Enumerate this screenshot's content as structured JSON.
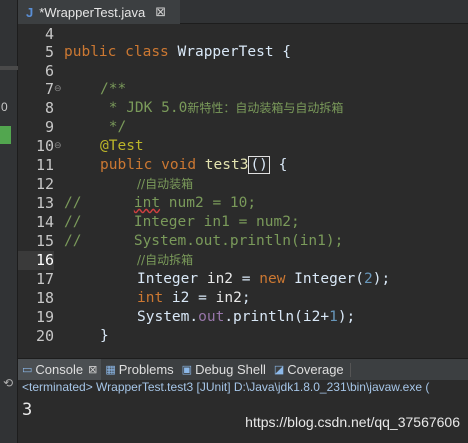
{
  "editor_tab": {
    "icon": "J",
    "label": "*WrapperTest.java",
    "close": "⊠"
  },
  "left_stub": {
    "number": "0"
  },
  "lines": [
    {
      "num": "4",
      "fold": ""
    },
    {
      "num": "5",
      "fold": ""
    },
    {
      "num": "6",
      "fold": ""
    },
    {
      "num": "7",
      "fold": "⊖"
    },
    {
      "num": "8",
      "fold": ""
    },
    {
      "num": "9",
      "fold": ""
    },
    {
      "num": "10",
      "fold": "⊖"
    },
    {
      "num": "11",
      "fold": ""
    },
    {
      "num": "12",
      "fold": ""
    },
    {
      "num": "13",
      "fold": ""
    },
    {
      "num": "14",
      "fold": ""
    },
    {
      "num": "15",
      "fold": ""
    },
    {
      "num": "16",
      "fold": ""
    },
    {
      "num": "17",
      "fold": ""
    },
    {
      "num": "18",
      "fold": ""
    },
    {
      "num": "19",
      "fold": ""
    },
    {
      "num": "20",
      "fold": ""
    }
  ],
  "code": {
    "l5_public": "public",
    "l5_class": "class",
    "l5_name": "WrapperTest {",
    "l7": "/**",
    "l8_star": " * JDK 5.0",
    "l8_cn": "新特性：自动装箱与自动拆箱",
    "l9": " */",
    "l10": "@Test",
    "l11_public": "public",
    "l11_void": "void",
    "l11_name": "test3",
    "l11_paren": "()",
    "l11_brace": " {",
    "l12": "//自动装箱",
    "l13_comment": "//",
    "l13_int": "int",
    "l13_rest": " num2 = 10;",
    "l14": "//      Integer in1 = num2;",
    "l15": "//      System.out.println(in1);",
    "l16": "//自动拆箱",
    "l17_type": "Integer ",
    "l17_var": "in2",
    "l17_eq": " = ",
    "l17_new": "new",
    "l17_cls": " Integer(",
    "l17_num": "2",
    "l17_end": ");",
    "l18_int": "int",
    "l18_var": " i2",
    "l18_eq": " = ",
    "l18_in2": "in2",
    "l18_end": ";",
    "l19_sys": "System.",
    "l19_out": "out",
    "l19_print": ".println(i2+",
    "l19_num": "1",
    "l19_end": ");",
    "l20": "}"
  },
  "console_tabs": [
    {
      "label": "Console",
      "icon": "▭",
      "close": "⊠"
    },
    {
      "label": "Problems",
      "icon": "▦"
    },
    {
      "label": "Debug Shell",
      "icon": "▣"
    },
    {
      "label": "Coverage",
      "icon": "◪"
    }
  ],
  "status_line": "<terminated> WrapperTest.test3 [JUnit] D:\\Java\\jdk1.8.0_231\\bin\\javaw.exe (",
  "console_output": "3",
  "watermark": "https://blog.csdn.net/qq_37567606"
}
